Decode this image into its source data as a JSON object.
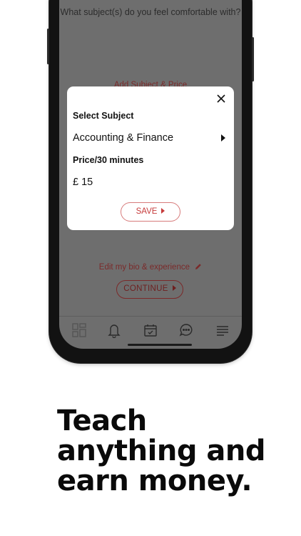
{
  "screen": {
    "question": "What subject(s) do you feel comfortable with?",
    "add_subject_label": "Add Subject & Price",
    "edit_bio_label": "Edit my bio & experience",
    "continue_label": "CONTINUE"
  },
  "modal": {
    "select_subject_label": "Select Subject",
    "subject_value": "Accounting & Finance",
    "price_label": "Price/30 minutes",
    "price_value": "£ 15",
    "save_label": "SAVE"
  },
  "tabbar": {
    "icons": [
      "dashboard-icon",
      "bell-icon",
      "calendar-icon",
      "chat-icon",
      "menu-icon"
    ]
  },
  "headline": [
    "Teach",
    "anything and",
    "earn money."
  ],
  "colors": {
    "accent": "#c63b3b",
    "overlay_text_accent": "#7b2a2a",
    "headline": "#0a0a0a"
  }
}
